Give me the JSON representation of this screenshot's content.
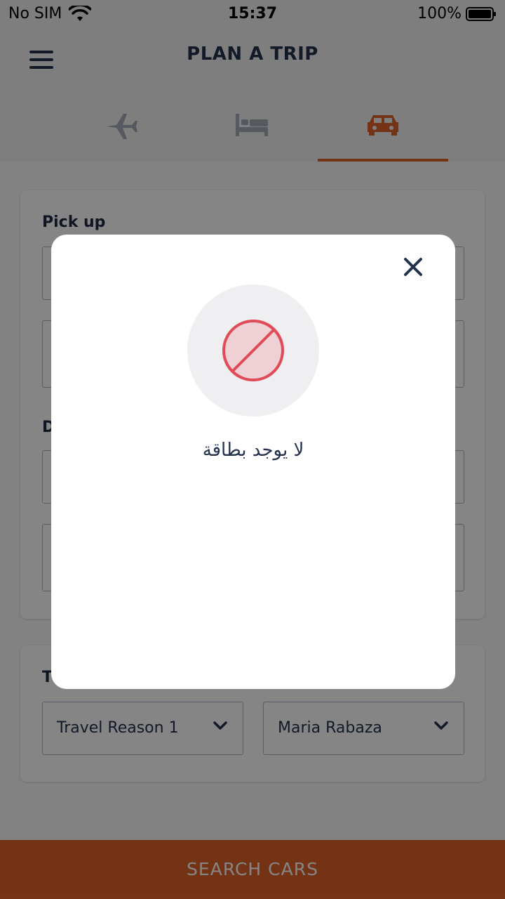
{
  "status_bar": {
    "carrier": "No SIM",
    "time": "15:37",
    "battery": "100%"
  },
  "header": {
    "title": "PLAN A TRIP",
    "tabs": [
      {
        "icon": "airplane-icon",
        "active": false
      },
      {
        "icon": "bed-icon",
        "active": false
      },
      {
        "icon": "car-icon",
        "active": true
      }
    ]
  },
  "form": {
    "pickup_label": "Pick up",
    "dropoff_label": "D",
    "traveler_label": "T",
    "travel_reason": "Travel Reason 1",
    "traveler": "Maria Rabaza"
  },
  "search_button": "SEARCH CARS",
  "modal": {
    "icon": "blocked-icon",
    "message": "لا يوجد بطاقة"
  },
  "colors": {
    "accent": "#e0632a",
    "primary_text": "#24324d",
    "blocked_red": "#e04b58"
  }
}
